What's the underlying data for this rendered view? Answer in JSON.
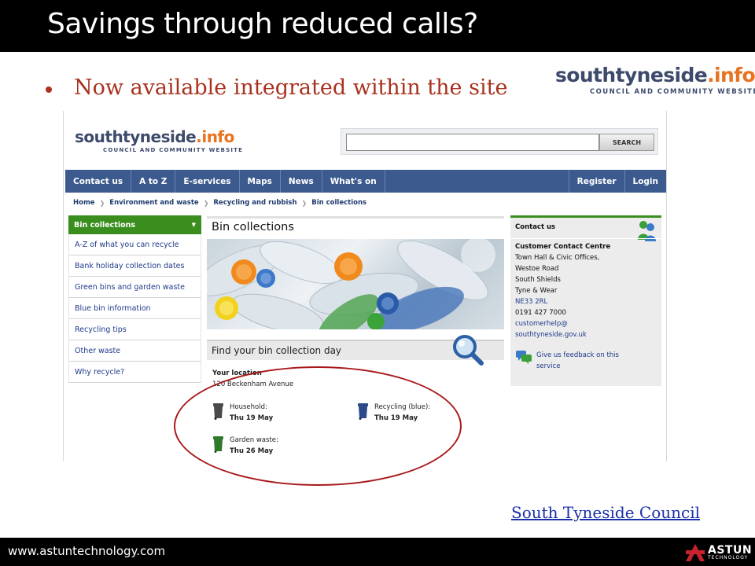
{
  "slide": {
    "title": "Savings through reduced calls?",
    "bullet": "Now available integrated within the site",
    "link": "South Tyneside Council",
    "footer_url": "www.astuntechnology.com",
    "astun_brand": "ASTUN",
    "astun_sub": "TECHNOLOGY"
  },
  "logo": {
    "word_dark": "southtyneside",
    "word_orange": ".info",
    "tagline": "COUNCIL AND COMMUNITY WEBSITE"
  },
  "site": {
    "search": {
      "value": "",
      "button": "SEARCH"
    },
    "nav": {
      "left": [
        "Contact us",
        "A to Z",
        "E-services",
        "Maps",
        "News",
        "What's on"
      ],
      "right": [
        "Register",
        "Login"
      ]
    },
    "breadcrumb": [
      "Home",
      "Environment and waste",
      "Recycling and rubbish",
      "Bin collections"
    ],
    "sidebar": {
      "active": "Bin collections",
      "items": [
        "A-Z of what you can recycle",
        "Bank holiday collection dates",
        "Green bins and garden waste",
        "Blue bin information",
        "Recycling tips",
        "Other waste",
        "Why recycle?"
      ]
    },
    "page_title": "Bin collections",
    "find_title": "Find your bin collection day",
    "location_label": "Your location",
    "location_value": "120 Beckenham Avenue",
    "bins": [
      {
        "name": "Household:",
        "date": "Thu 19 May",
        "color": "#4a4a4a"
      },
      {
        "name": "Recycling (blue):",
        "date": "Thu 19 May",
        "color": "#2c4a8a"
      },
      {
        "name": "Garden waste:",
        "date": "Thu 26 May",
        "color": "#2f7a2a"
      }
    ],
    "contact": {
      "heading": "Contact us",
      "centre": "Customer Contact Centre",
      "address": [
        "Town Hall & Civic Offices,",
        "Westoe Road",
        "South Shields",
        "Tyne & Wear"
      ],
      "postcode": "NE33 2RL",
      "phone": "0191 427 7000",
      "email_line1": "customerhelp@",
      "email_line2": "southtyneside.gov.uk",
      "feedback_line1": "Give us feedback on this",
      "feedback_line2": "service"
    }
  },
  "colors": {
    "title_bar": "#000000",
    "bullet": "#a8321e",
    "nav": "#3c5a8e",
    "sidebar_active": "#3a8e1e",
    "highlight": "#a8191c",
    "logo_orange": "#e8731f",
    "logo_dark": "#3d4a6b"
  }
}
